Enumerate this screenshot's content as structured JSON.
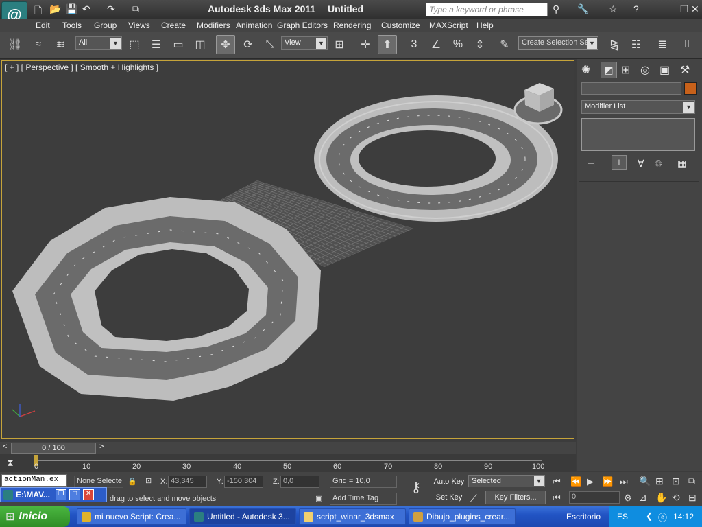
{
  "title": {
    "app": "Autodesk 3ds Max  2011",
    "doc": "Untitled",
    "search_placeholder": "Type a keyword or phrase"
  },
  "menus": [
    "Edit",
    "Tools",
    "Group",
    "Views",
    "Create",
    "Modifiers",
    "Animation",
    "Graph Editors",
    "Rendering",
    "Customize",
    "MAXScript",
    "Help"
  ],
  "toolbar": {
    "selection_filter": "All",
    "ref_coord": "View",
    "selection_set": "Create Selection Se"
  },
  "viewport": {
    "label": "[ + ] [ Perspective ] [ Smooth + Highlights ]"
  },
  "cmd": {
    "modifier_list": "Modifier List",
    "color": "#c8611a"
  },
  "timeline": {
    "frame": "0 / 100",
    "ticks": [
      "0",
      "10",
      "20",
      "30",
      "40",
      "50",
      "60",
      "70",
      "80",
      "90",
      "100"
    ]
  },
  "status": {
    "listener": "actionMan.ex",
    "selection": "None Selecte",
    "x_label": "X:",
    "x": "43,345",
    "y_label": "Y:",
    "y": "-150,304",
    "z_label": "Z:",
    "z": "0,0",
    "grid": "Grid = 10,0",
    "add_time_tag": "Add Time Tag",
    "prompt": "drag to select and move objects",
    "auto_key": "Auto Key",
    "set_key": "Set Key",
    "key_mode": "Selected",
    "key_filters": "Key Filters...",
    "current_frame": "0",
    "mini_window": "E:\\MAV..."
  },
  "taskbar": {
    "start": "Inicio",
    "tasks": [
      "mi nuevo Script: Crea...",
      "Untitled - Autodesk 3...",
      "script_winar_3dsmax",
      "Dibujo_plugins_crear..."
    ],
    "desktop": "Escritorio",
    "lang": "ES",
    "clock": "14:12"
  },
  "colors": {
    "accent": "#c6a43a",
    "start": "#3b9a2f"
  }
}
